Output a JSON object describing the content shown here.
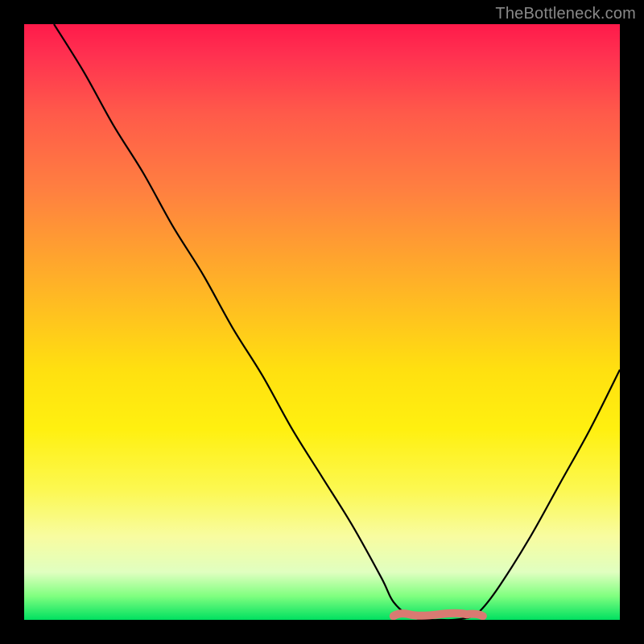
{
  "watermark": "TheBottleneck.com",
  "chart_data": {
    "type": "line",
    "title": "",
    "xlabel": "",
    "ylabel": "",
    "xlim": [
      0,
      100
    ],
    "ylim": [
      0,
      100
    ],
    "series": [
      {
        "name": "bottleneck-curve",
        "x": [
          5,
          10,
          15,
          20,
          25,
          30,
          35,
          40,
          45,
          50,
          55,
          60,
          62,
          65,
          68,
          70,
          72,
          75,
          77,
          80,
          85,
          90,
          95,
          100
        ],
        "y": [
          100,
          92,
          83,
          75,
          66,
          58,
          49,
          41,
          32,
          24,
          16,
          7,
          3,
          0.5,
          0,
          0,
          0,
          0.5,
          2,
          6,
          14,
          23,
          32,
          42
        ]
      },
      {
        "name": "flat-region-marker",
        "x": [
          62,
          77
        ],
        "y": [
          0.5,
          0.5
        ]
      }
    ],
    "colors": {
      "curve": "#000000",
      "marker": "#d97a72",
      "gradient_top": "#ff1a4a",
      "gradient_mid": "#ffe010",
      "gradient_bottom": "#00e060"
    }
  }
}
